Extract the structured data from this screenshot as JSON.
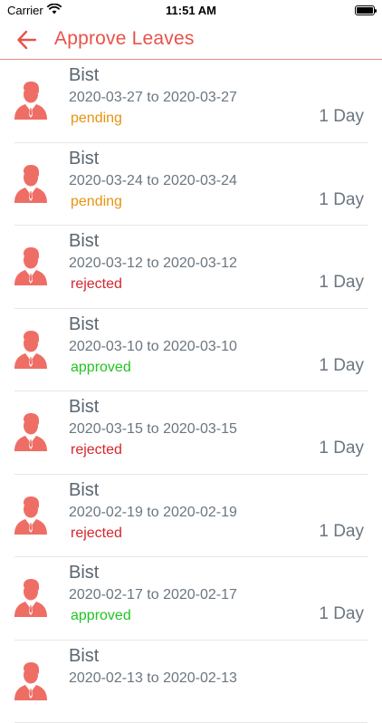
{
  "status_bar": {
    "carrier": "Carrier",
    "time": "11:51 AM"
  },
  "header": {
    "title": "Approve Leaves",
    "back_icon": "arrow-left-icon"
  },
  "colors": {
    "accent": "#e8524a",
    "pending": "#e8920f",
    "rejected": "#d6262e",
    "approved": "#22c422",
    "avatar": "#ee6e66"
  },
  "leaves": [
    {
      "name": "Bist",
      "dates": "2020-03-27 to 2020-03-27",
      "status": "pending",
      "duration": "1 Day"
    },
    {
      "name": "Bist",
      "dates": "2020-03-24 to 2020-03-24",
      "status": "pending",
      "duration": "1 Day"
    },
    {
      "name": "Bist",
      "dates": "2020-03-12 to 2020-03-12",
      "status": "rejected",
      "duration": "1 Day"
    },
    {
      "name": "Bist",
      "dates": "2020-03-10 to 2020-03-10",
      "status": "approved",
      "duration": "1 Day"
    },
    {
      "name": "Bist",
      "dates": "2020-03-15 to 2020-03-15",
      "status": "rejected",
      "duration": "1 Day"
    },
    {
      "name": "Bist",
      "dates": "2020-02-19 to 2020-02-19",
      "status": "rejected",
      "duration": "1 Day"
    },
    {
      "name": "Bist",
      "dates": "2020-02-17 to 2020-02-17",
      "status": "approved",
      "duration": "1 Day"
    },
    {
      "name": "Bist",
      "dates": "2020-02-13 to 2020-02-13",
      "status": "",
      "duration": ""
    }
  ]
}
